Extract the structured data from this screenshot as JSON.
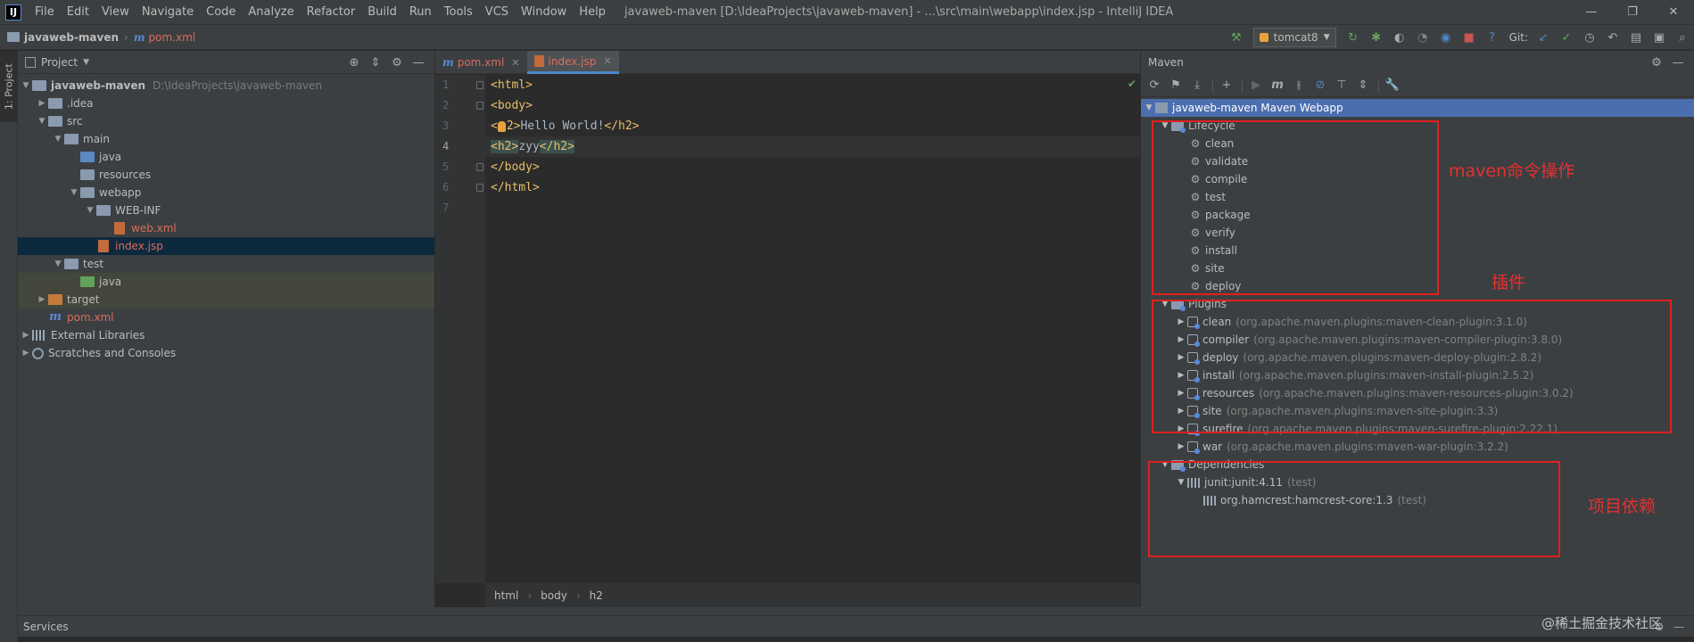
{
  "menubar": {
    "logo": "IJ",
    "items": [
      "File",
      "Edit",
      "View",
      "Navigate",
      "Code",
      "Analyze",
      "Refactor",
      "Build",
      "Run",
      "Tools",
      "VCS",
      "Window",
      "Help"
    ],
    "window_title": "javaweb-maven [D:\\IdeaProjects\\javaweb-maven] - ...\\src\\main\\webapp\\index.jsp - IntelliJ IDEA",
    "controls": [
      "—",
      "❐",
      "✕"
    ]
  },
  "navbar": {
    "project": "javaweb-maven",
    "file": "pom.xml",
    "run_config": "tomcat8",
    "git_label": "Git:"
  },
  "left_strip": {
    "project_tab": "1: Project"
  },
  "project_panel": {
    "title": "Project",
    "tree": [
      {
        "label": "javaweb-maven",
        "path": "D:\\IdeaProjects\\javaweb-maven"
      },
      {
        "label": ".idea"
      },
      {
        "label": "src"
      },
      {
        "label": "main"
      },
      {
        "label": "java"
      },
      {
        "label": "resources"
      },
      {
        "label": "webapp"
      },
      {
        "label": "WEB-INF"
      },
      {
        "label": "web.xml"
      },
      {
        "label": "index.jsp"
      },
      {
        "label": "test"
      },
      {
        "label": "java"
      },
      {
        "label": "target"
      },
      {
        "label": "pom.xml"
      },
      {
        "label": "External Libraries"
      },
      {
        "label": "Scratches and Consoles"
      }
    ]
  },
  "editor": {
    "tabs": [
      {
        "label": "pom.xml"
      },
      {
        "label": "index.jsp"
      }
    ],
    "line_numbers": [
      "1",
      "2",
      "3",
      "4",
      "5",
      "6",
      "7"
    ],
    "lines": {
      "l1": "<html>",
      "l2": "<body>",
      "l3_open": "<",
      "l3_rest": "2>",
      "l3_text": "Hello World!",
      "l3_close": "</h2>",
      "l4_open": "<h2>",
      "l4_text": "zyy",
      "l4_close": "</h2>",
      "l5": "</body>",
      "l6": "</html>"
    },
    "breadcrumb": [
      "html",
      "body",
      "h2"
    ]
  },
  "maven_panel": {
    "title": "Maven",
    "root": "javaweb-maven Maven Webapp",
    "lifecycle_label": "Lifecycle",
    "lifecycle": [
      "clean",
      "validate",
      "compile",
      "test",
      "package",
      "verify",
      "install",
      "site",
      "deploy"
    ],
    "plugins_label": "Plugins",
    "plugins": [
      {
        "name": "clean",
        "id": "(org.apache.maven.plugins:maven-clean-plugin:3.1.0)"
      },
      {
        "name": "compiler",
        "id": "(org.apache.maven.plugins:maven-compiler-plugin:3.8.0)"
      },
      {
        "name": "deploy",
        "id": "(org.apache.maven.plugins:maven-deploy-plugin:2.8.2)"
      },
      {
        "name": "install",
        "id": "(org.apache.maven.plugins:maven-install-plugin:2.5.2)"
      },
      {
        "name": "resources",
        "id": "(org.apache.maven.plugins:maven-resources-plugin:3.0.2)"
      },
      {
        "name": "site",
        "id": "(org.apache.maven.plugins:maven-site-plugin:3.3)"
      },
      {
        "name": "surefire",
        "id": "(org.apache.maven.plugins:maven-surefire-plugin:2.22.1)"
      },
      {
        "name": "war",
        "id": "(org.apache.maven.plugins:maven-war-plugin:3.2.2)"
      }
    ],
    "dependencies_label": "Dependencies",
    "dependencies": [
      {
        "name": "junit:junit:4.11",
        "scope": "(test)"
      },
      {
        "name": "org.hamcrest:hamcrest-core:1.3",
        "scope": "(test)"
      }
    ]
  },
  "annotations": {
    "lifecycle": "maven命令操作",
    "plugins": "插件",
    "dependencies": "项目依赖"
  },
  "bottom": {
    "services": "Services",
    "watermark": "@稀土掘金技术社区"
  },
  "colors": {
    "annotation_red": "#e02020",
    "selection": "#4b6eaf",
    "file_red": "#d96d5c"
  }
}
